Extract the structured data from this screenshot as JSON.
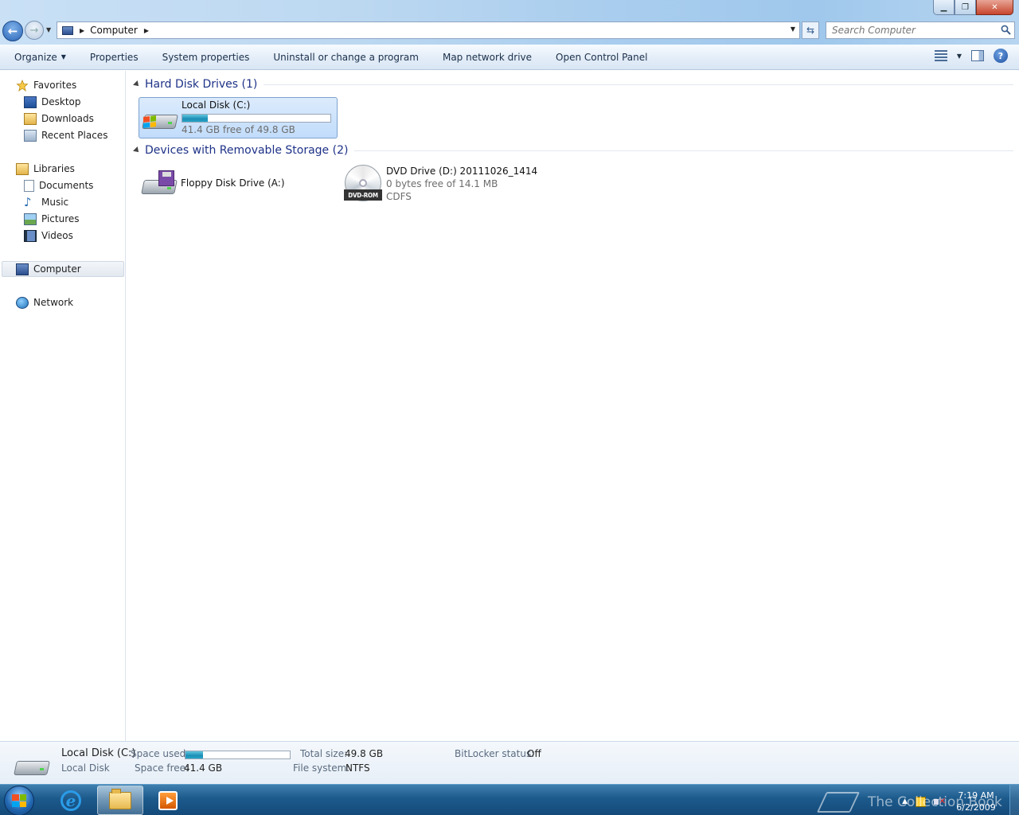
{
  "address": {
    "crumbs": [
      "Computer"
    ],
    "search_placeholder": "Search Computer"
  },
  "toolbar": {
    "organize": "Organize",
    "properties": "Properties",
    "system_properties": "System properties",
    "uninstall": "Uninstall or change a program",
    "map_drive": "Map network drive",
    "control_panel": "Open Control Panel"
  },
  "nav": {
    "favorites": "Favorites",
    "desktop": "Desktop",
    "downloads": "Downloads",
    "recent": "Recent Places",
    "libraries": "Libraries",
    "documents": "Documents",
    "music": "Music",
    "pictures": "Pictures",
    "videos": "Videos",
    "computer": "Computer",
    "network": "Network"
  },
  "groups": {
    "hdd": "Hard Disk Drives (1)",
    "removable": "Devices with Removable Storage (2)"
  },
  "drives": {
    "c": {
      "name": "Local Disk (C:)",
      "free": "41.4 GB free of 49.8 GB",
      "used_fraction": 0.17
    },
    "a": {
      "name": "Floppy Disk Drive (A:)"
    },
    "d": {
      "name": "DVD Drive (D:) 20111026_1414",
      "free": "0 bytes free of 14.1 MB",
      "fs": "CDFS",
      "tag": "DVD-ROM"
    }
  },
  "details": {
    "name": "Local Disk (C:)",
    "type": "Local Disk",
    "space_used_label": "Space used:",
    "space_free_label": "Space free:",
    "space_free": "41.4 GB",
    "total_size_label": "Total size:",
    "total_size": "49.8 GB",
    "fs_label": "File system:",
    "fs": "NTFS",
    "bitlocker_label": "BitLocker status:",
    "bitlocker": "Off",
    "used_fraction": 0.17
  },
  "taskbar": {
    "time": "7:19 AM",
    "date": "6/2/2009",
    "watermark": "The Collection Book"
  },
  "colors": {
    "group_header": "#1e3287",
    "capacity_fill": "#1d8db5",
    "taskbar": "#1d5a8c"
  }
}
